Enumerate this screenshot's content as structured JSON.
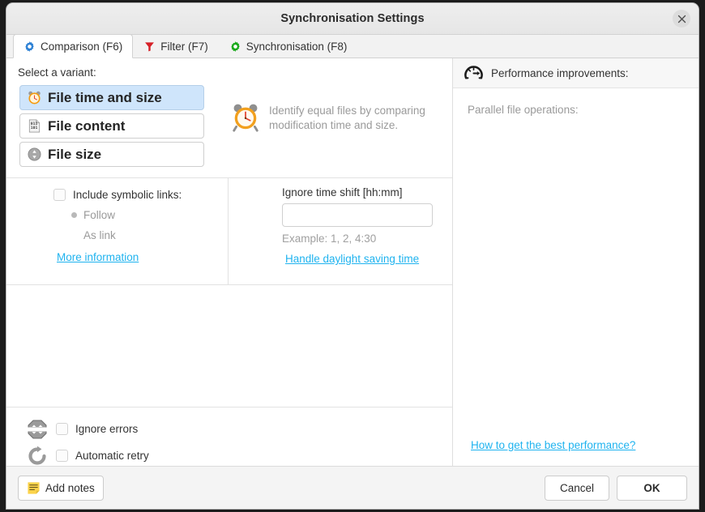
{
  "window": {
    "title": "Synchronisation Settings",
    "close_icon": "close-icon"
  },
  "tabs": [
    {
      "label": "Comparison (F6)",
      "icon": "blue-gear-icon",
      "active": true
    },
    {
      "label": "Filter (F7)",
      "icon": "red-funnel-icon",
      "active": false
    },
    {
      "label": "Synchronisation (F8)",
      "icon": "green-gear-icon",
      "active": false
    }
  ],
  "comparison": {
    "select_variant_label": "Select a variant:",
    "variants": [
      {
        "label": "File time and size",
        "icon": "alarm-clock-icon",
        "selected": true
      },
      {
        "label": "File content",
        "icon": "binary-document-icon",
        "selected": false
      },
      {
        "label": "File size",
        "icon": "file-size-icon",
        "selected": false
      }
    ],
    "description": "Identify equal files by comparing modification time and size.",
    "description_icon": "alarm-clock-large-icon"
  },
  "symlinks": {
    "include_label": "Include symbolic links:",
    "include_checked": false,
    "options": [
      {
        "label": "Follow",
        "selected": true
      },
      {
        "label": "As link",
        "selected": false
      }
    ],
    "more_information": "More information"
  },
  "time_shift": {
    "label": "Ignore time shift [hh:mm]",
    "value": "",
    "placeholder": "",
    "example": "Example:  1, 2, 4:30",
    "dst_link": "Handle daylight saving time"
  },
  "error_handling": {
    "items": [
      {
        "label": "Ignore errors",
        "icon": "stop-sign-icon",
        "checked": false
      },
      {
        "label": "Automatic retry",
        "icon": "retry-arrow-icon",
        "checked": false
      }
    ]
  },
  "performance": {
    "header": "Performance improvements:",
    "header_icon": "speedometer-icon",
    "parallel_label": "Parallel file operations:",
    "best_performance_link": "How to get the best performance?"
  },
  "footer": {
    "add_notes": "Add notes",
    "add_notes_icon": "note-icon",
    "cancel": "Cancel",
    "ok": "OK"
  },
  "colors": {
    "link": "#1fb3ef",
    "selection": "#cfe5fb",
    "muted_text": "#9a9a9a"
  }
}
